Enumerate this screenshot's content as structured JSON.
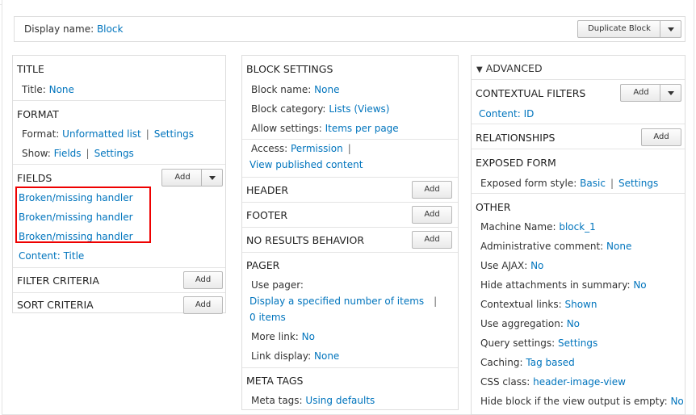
{
  "display": {
    "label": "Display name:",
    "value": "Block",
    "duplicate_button": "Duplicate Block"
  },
  "left": {
    "title": {
      "heading": "TITLE",
      "label": "Title:",
      "value": "None"
    },
    "format": {
      "heading": "FORMAT",
      "format_label": "Format:",
      "format_value": "Unformatted list",
      "format_settings": "Settings",
      "show_label": "Show:",
      "show_value": "Fields",
      "show_settings": "Settings"
    },
    "fields": {
      "heading": "FIELDS",
      "add": "Add",
      "items": [
        "Broken/missing handler",
        "Broken/missing handler",
        "Broken/missing handler",
        "Content: Title"
      ]
    },
    "filter": {
      "heading": "FILTER CRITERIA",
      "add": "Add"
    },
    "sort": {
      "heading": "SORT CRITERIA",
      "add": "Add"
    }
  },
  "middle": {
    "block_settings": {
      "heading": "BLOCK SETTINGS",
      "name_label": "Block name:",
      "name_value": "None",
      "category_label": "Block category:",
      "category_value": "Lists (Views)",
      "allow_label": "Allow settings:",
      "allow_value": "Items per page",
      "access_label": "Access:",
      "access_value": "Permission",
      "access_sub": "View published content"
    },
    "header": {
      "heading": "HEADER",
      "add": "Add"
    },
    "footer": {
      "heading": "FOOTER",
      "add": "Add"
    },
    "no_results": {
      "heading": "NO RESULTS BEHAVIOR",
      "add": "Add"
    },
    "pager": {
      "heading": "PAGER",
      "use_label": "Use pager:",
      "use_value": "Display a specified number of items",
      "use_count": "0 items",
      "more_label": "More link:",
      "more_value": "No",
      "display_label": "Link display:",
      "display_value": "None"
    },
    "meta": {
      "heading": "META TAGS",
      "label": "Meta tags:",
      "value": "Using defaults"
    }
  },
  "right": {
    "advanced": "ADVANCED",
    "contextual": {
      "heading": "CONTEXTUAL FILTERS",
      "add": "Add",
      "item": "Content: ID"
    },
    "relationships": {
      "heading": "RELATIONSHIPS",
      "add": "Add"
    },
    "exposed": {
      "heading": "EXPOSED FORM",
      "label": "Exposed form style:",
      "value": "Basic",
      "settings": "Settings"
    },
    "other": {
      "heading": "OTHER",
      "rows": [
        {
          "label": "Machine Name:",
          "value": "block_1"
        },
        {
          "label": "Administrative comment:",
          "value": "None"
        },
        {
          "label": "Use AJAX:",
          "value": "No"
        },
        {
          "label": "Hide attachments in summary:",
          "value": "No"
        },
        {
          "label": "Contextual links:",
          "value": "Shown"
        },
        {
          "label": "Use aggregation:",
          "value": "No"
        },
        {
          "label": "Query settings:",
          "value": "Settings"
        },
        {
          "label": "Caching:",
          "value": "Tag based"
        },
        {
          "label": "CSS class:",
          "value": "header-image-view"
        },
        {
          "label": "Hide block if the view output is empty:",
          "value": "No"
        }
      ]
    }
  }
}
